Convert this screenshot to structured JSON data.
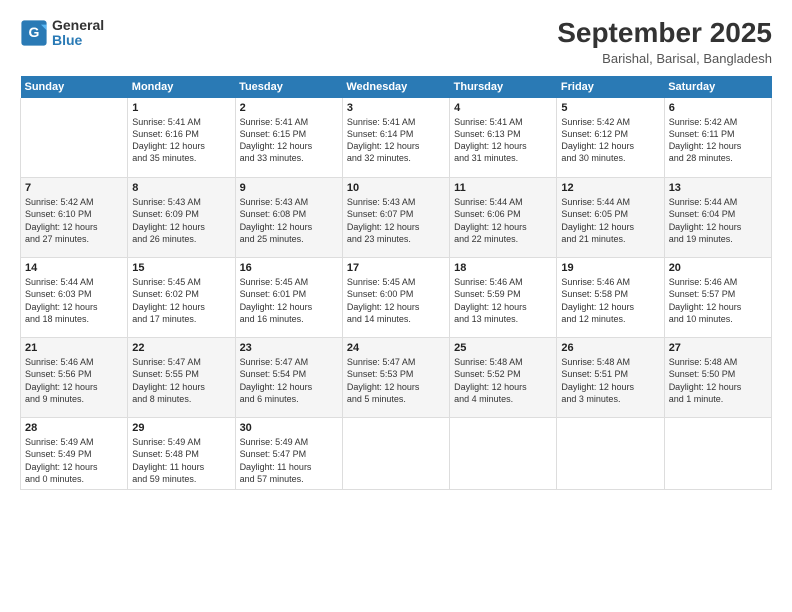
{
  "logo": {
    "text_general": "General",
    "text_blue": "Blue"
  },
  "header": {
    "month_title": "September 2025",
    "location": "Barishal, Barisal, Bangladesh"
  },
  "weekdays": [
    "Sunday",
    "Monday",
    "Tuesday",
    "Wednesday",
    "Thursday",
    "Friday",
    "Saturday"
  ],
  "weeks": [
    [
      {
        "day": null,
        "info": ""
      },
      {
        "day": "1",
        "info": "Sunrise: 5:41 AM\nSunset: 6:16 PM\nDaylight: 12 hours\nand 35 minutes."
      },
      {
        "day": "2",
        "info": "Sunrise: 5:41 AM\nSunset: 6:15 PM\nDaylight: 12 hours\nand 33 minutes."
      },
      {
        "day": "3",
        "info": "Sunrise: 5:41 AM\nSunset: 6:14 PM\nDaylight: 12 hours\nand 32 minutes."
      },
      {
        "day": "4",
        "info": "Sunrise: 5:41 AM\nSunset: 6:13 PM\nDaylight: 12 hours\nand 31 minutes."
      },
      {
        "day": "5",
        "info": "Sunrise: 5:42 AM\nSunset: 6:12 PM\nDaylight: 12 hours\nand 30 minutes."
      },
      {
        "day": "6",
        "info": "Sunrise: 5:42 AM\nSunset: 6:11 PM\nDaylight: 12 hours\nand 28 minutes."
      }
    ],
    [
      {
        "day": "7",
        "info": "Sunrise: 5:42 AM\nSunset: 6:10 PM\nDaylight: 12 hours\nand 27 minutes."
      },
      {
        "day": "8",
        "info": "Sunrise: 5:43 AM\nSunset: 6:09 PM\nDaylight: 12 hours\nand 26 minutes."
      },
      {
        "day": "9",
        "info": "Sunrise: 5:43 AM\nSunset: 6:08 PM\nDaylight: 12 hours\nand 25 minutes."
      },
      {
        "day": "10",
        "info": "Sunrise: 5:43 AM\nSunset: 6:07 PM\nDaylight: 12 hours\nand 23 minutes."
      },
      {
        "day": "11",
        "info": "Sunrise: 5:44 AM\nSunset: 6:06 PM\nDaylight: 12 hours\nand 22 minutes."
      },
      {
        "day": "12",
        "info": "Sunrise: 5:44 AM\nSunset: 6:05 PM\nDaylight: 12 hours\nand 21 minutes."
      },
      {
        "day": "13",
        "info": "Sunrise: 5:44 AM\nSunset: 6:04 PM\nDaylight: 12 hours\nand 19 minutes."
      }
    ],
    [
      {
        "day": "14",
        "info": "Sunrise: 5:44 AM\nSunset: 6:03 PM\nDaylight: 12 hours\nand 18 minutes."
      },
      {
        "day": "15",
        "info": "Sunrise: 5:45 AM\nSunset: 6:02 PM\nDaylight: 12 hours\nand 17 minutes."
      },
      {
        "day": "16",
        "info": "Sunrise: 5:45 AM\nSunset: 6:01 PM\nDaylight: 12 hours\nand 16 minutes."
      },
      {
        "day": "17",
        "info": "Sunrise: 5:45 AM\nSunset: 6:00 PM\nDaylight: 12 hours\nand 14 minutes."
      },
      {
        "day": "18",
        "info": "Sunrise: 5:46 AM\nSunset: 5:59 PM\nDaylight: 12 hours\nand 13 minutes."
      },
      {
        "day": "19",
        "info": "Sunrise: 5:46 AM\nSunset: 5:58 PM\nDaylight: 12 hours\nand 12 minutes."
      },
      {
        "day": "20",
        "info": "Sunrise: 5:46 AM\nSunset: 5:57 PM\nDaylight: 12 hours\nand 10 minutes."
      }
    ],
    [
      {
        "day": "21",
        "info": "Sunrise: 5:46 AM\nSunset: 5:56 PM\nDaylight: 12 hours\nand 9 minutes."
      },
      {
        "day": "22",
        "info": "Sunrise: 5:47 AM\nSunset: 5:55 PM\nDaylight: 12 hours\nand 8 minutes."
      },
      {
        "day": "23",
        "info": "Sunrise: 5:47 AM\nSunset: 5:54 PM\nDaylight: 12 hours\nand 6 minutes."
      },
      {
        "day": "24",
        "info": "Sunrise: 5:47 AM\nSunset: 5:53 PM\nDaylight: 12 hours\nand 5 minutes."
      },
      {
        "day": "25",
        "info": "Sunrise: 5:48 AM\nSunset: 5:52 PM\nDaylight: 12 hours\nand 4 minutes."
      },
      {
        "day": "26",
        "info": "Sunrise: 5:48 AM\nSunset: 5:51 PM\nDaylight: 12 hours\nand 3 minutes."
      },
      {
        "day": "27",
        "info": "Sunrise: 5:48 AM\nSunset: 5:50 PM\nDaylight: 12 hours\nand 1 minute."
      }
    ],
    [
      {
        "day": "28",
        "info": "Sunrise: 5:49 AM\nSunset: 5:49 PM\nDaylight: 12 hours\nand 0 minutes."
      },
      {
        "day": "29",
        "info": "Sunrise: 5:49 AM\nSunset: 5:48 PM\nDaylight: 11 hours\nand 59 minutes."
      },
      {
        "day": "30",
        "info": "Sunrise: 5:49 AM\nSunset: 5:47 PM\nDaylight: 11 hours\nand 57 minutes."
      },
      {
        "day": null,
        "info": ""
      },
      {
        "day": null,
        "info": ""
      },
      {
        "day": null,
        "info": ""
      },
      {
        "day": null,
        "info": ""
      }
    ]
  ]
}
